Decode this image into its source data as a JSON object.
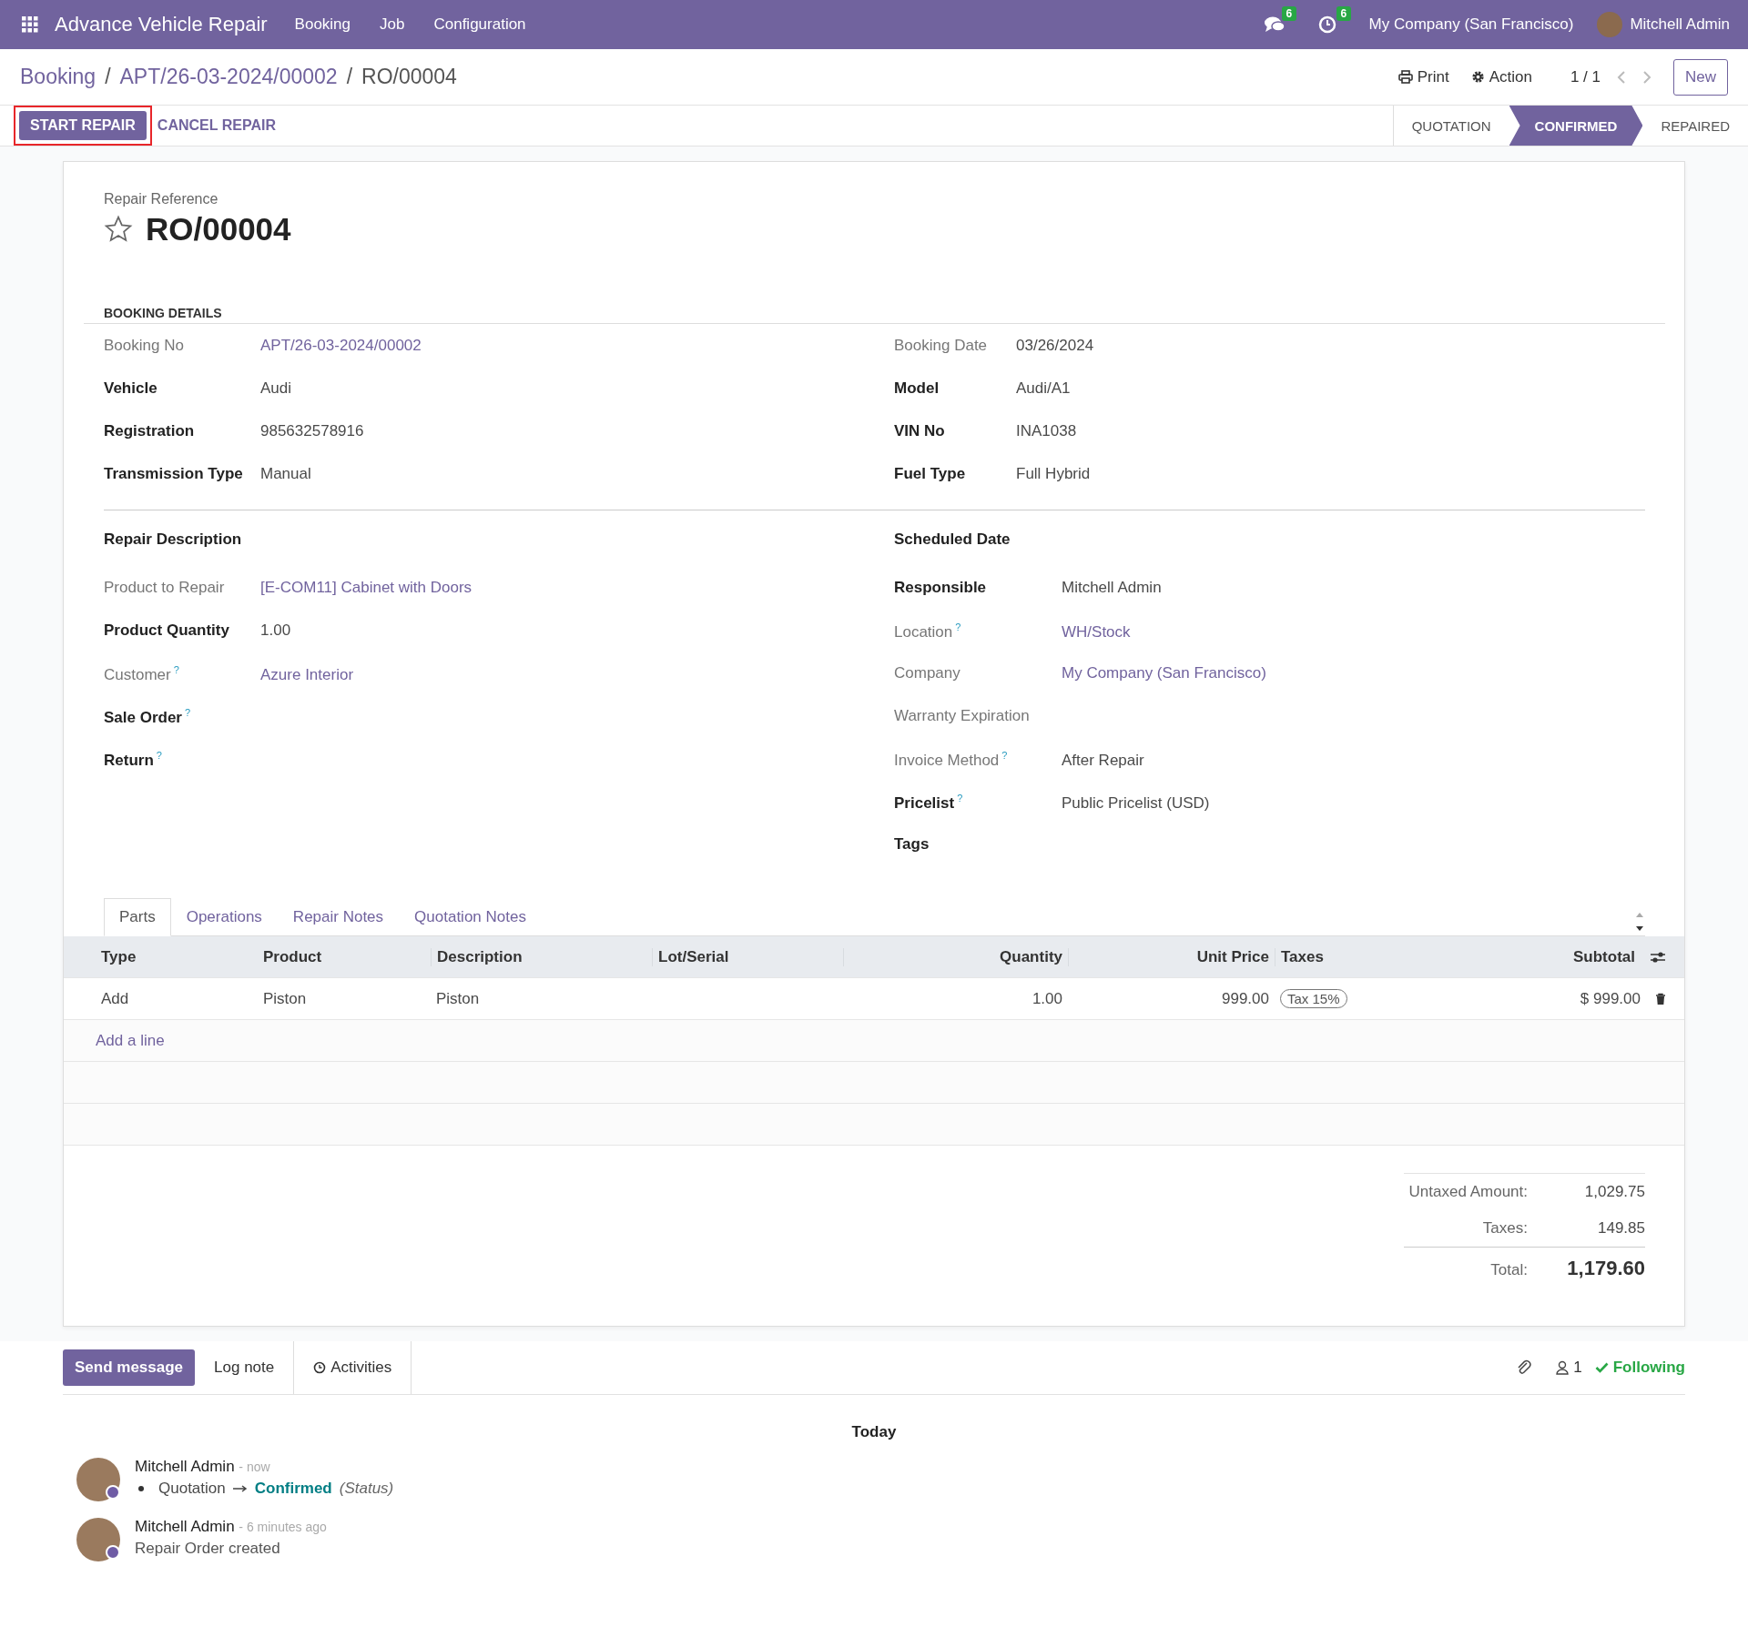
{
  "navbar": {
    "app_name": "Advance Vehicle Repair",
    "menu": [
      "Booking",
      "Job",
      "Configuration"
    ],
    "messages_count": "6",
    "activities_count": "6",
    "company": "My Company (San Francisco)",
    "user": "Mitchell Admin"
  },
  "breadcrumbs": [
    "Booking",
    "APT/26-03-2024/00002",
    "RO/00004"
  ],
  "breadcrumb_separator": "/",
  "control_panel": {
    "print": "Print",
    "action": "Action",
    "pager": "1 / 1",
    "new": "New"
  },
  "header_buttons": [
    {
      "label": "START REPAIR",
      "kind": "primary",
      "highlighted": true
    },
    {
      "label": "CANCEL REPAIR",
      "kind": "link",
      "highlighted": false
    }
  ],
  "status_steps": [
    {
      "label": "QUOTATION",
      "selected": false
    },
    {
      "label": "CONFIRMED",
      "selected": true
    },
    {
      "label": "REPAIRED",
      "selected": false
    }
  ],
  "form": {
    "reference_label": "Repair Reference",
    "reference": "RO/00004",
    "starred": false,
    "section_title": "BOOKING DETAILS",
    "booking_left": [
      {
        "label": "Booking No",
        "value": "APT/26-03-2024/00002",
        "kind": "link",
        "required": false
      },
      {
        "label": "Vehicle",
        "value": "Audi",
        "kind": "text",
        "required": true
      },
      {
        "label": "Registration",
        "value": "985632578916",
        "kind": "text",
        "required": true
      },
      {
        "label": "Transmission Type",
        "value": "Manual",
        "kind": "text",
        "required": true
      }
    ],
    "booking_right": [
      {
        "label": "Booking Date",
        "value": "03/26/2024",
        "kind": "text",
        "required": false
      },
      {
        "label": "Model",
        "value": "Audi/A1",
        "kind": "text",
        "required": true
      },
      {
        "label": "VIN No",
        "value": "INA1038",
        "kind": "text",
        "required": true
      },
      {
        "label": "Fuel Type",
        "value": "Full Hybrid",
        "kind": "text",
        "required": true
      }
    ],
    "repair_left": [
      {
        "label": "Repair Description",
        "kind": "heading",
        "required": true
      },
      {
        "label": "Product to Repair",
        "value": "[E-COM11] Cabinet with Doors",
        "kind": "link",
        "required": false
      },
      {
        "label": "Product Quantity",
        "value": "1.00",
        "kind": "text",
        "required": true
      },
      {
        "label": "Customer",
        "help": "?",
        "value": "Azure Interior",
        "kind": "link",
        "required": false
      },
      {
        "label": "Sale Order",
        "help": "?",
        "kind": "text",
        "required": true
      },
      {
        "label": "Return",
        "help": "?",
        "kind": "text",
        "required": true
      }
    ],
    "repair_right": [
      {
        "label": "Scheduled Date",
        "kind": "heading",
        "required": true
      },
      {
        "label": "Responsible",
        "value": "Mitchell Admin",
        "kind": "text",
        "required": true
      },
      {
        "label": "Location",
        "help": "?",
        "value": "WH/Stock",
        "kind": "link",
        "required": false
      },
      {
        "label": "Company",
        "value": "My Company (San Francisco)",
        "kind": "link",
        "required": false
      },
      {
        "label": "Warranty Expiration",
        "kind": "text",
        "required": false
      },
      {
        "label": "Invoice Method",
        "help": "?",
        "value": "After Repair",
        "kind": "text",
        "required": false
      },
      {
        "label": "Pricelist",
        "help": "?",
        "value": "Public Pricelist (USD)",
        "kind": "text",
        "required": true
      },
      {
        "label": "Tags",
        "kind": "text",
        "required": true
      }
    ]
  },
  "tabs": [
    {
      "label": "Parts",
      "selected": true
    },
    {
      "label": "Operations",
      "selected": false
    },
    {
      "label": "Repair Notes",
      "selected": false
    },
    {
      "label": "Quotation Notes",
      "selected": false
    }
  ],
  "table": {
    "columns": [
      "Type",
      "Product",
      "Description",
      "Lot/Serial",
      "Quantity",
      "Unit Price",
      "Taxes",
      "Subtotal"
    ],
    "rows": [
      {
        "type": "Add",
        "product": "Piston",
        "description": "Piston",
        "lot_serial": "",
        "quantity": "1.00",
        "unit_price": "999.00",
        "taxes": [
          "Tax 15%"
        ],
        "subtotal": "$ 999.00"
      }
    ],
    "add_line": "Add a line"
  },
  "totals": [
    {
      "label": "Untaxed Amount:",
      "value": "1,029.75",
      "kind": "normal"
    },
    {
      "label": "Taxes:",
      "value": "149.85",
      "kind": "normal"
    },
    {
      "label": "Total:",
      "value": "1,179.60",
      "kind": "total"
    }
  ],
  "chatter": {
    "send_message": "Send message",
    "log_note": "Log note",
    "activities": "Activities",
    "followers": "1",
    "following": "Following",
    "date_separator": "Today",
    "messages": [
      {
        "author": "Mitchell Admin",
        "time": "- now",
        "kind": "tracking",
        "old_value": "Quotation",
        "new_value": "Confirmed",
        "field": "(Status)"
      },
      {
        "author": "Mitchell Admin",
        "time": "- 6 minutes ago",
        "kind": "text",
        "body": "Repair Order created"
      }
    ]
  }
}
